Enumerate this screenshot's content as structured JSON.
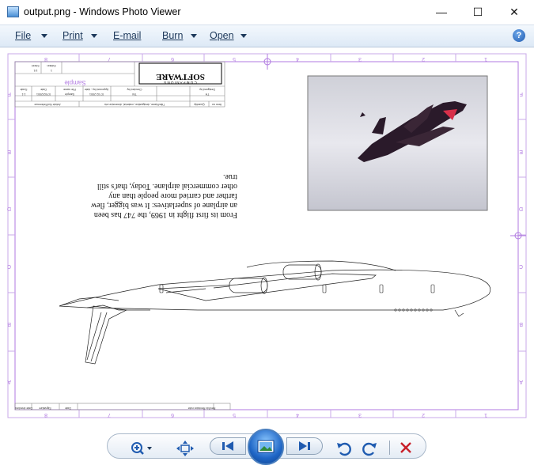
{
  "window": {
    "title": "output.png - Windows Photo Viewer",
    "minimize_glyph": "—",
    "maximize_glyph": "☐",
    "close_glyph": "✕"
  },
  "menu": [
    {
      "label": "File",
      "has_dropdown": true
    },
    {
      "label": "Print",
      "has_dropdown": true
    },
    {
      "label": "E-mail",
      "has_dropdown": false
    },
    {
      "label": "Burn",
      "has_dropdown": true
    },
    {
      "label": "Open",
      "has_dropdown": true
    }
  ],
  "help_glyph": "?",
  "drawing": {
    "title_block": {
      "logo_line1": "SOFTWARE",
      "logo_line2": "C O M P A N I O N S",
      "sample": "Sample",
      "sheet": "Sheet",
      "sheet_value": "1/1",
      "edition": "Edition",
      "edition_value": "1",
      "scale": "Scale",
      "scale_value": "1:1",
      "date": "Date",
      "date_value": "07/02/2001",
      "file_name": "File name",
      "file_name_value": "Sample",
      "approved_by": "Approved by - date",
      "approved_value": "07.02.2001",
      "checked_by": "Checked by",
      "checked_value": "TM",
      "designed_by": "Designed by",
      "designed_value": "TH",
      "article_no": "Article No/Reference",
      "title_name": "Title/Name, designation, material, dimension etc",
      "quantity": "Quantity",
      "item_no": "Item no",
      "revision_note": "Rev/No  Revision note",
      "signature": "Signature",
      "date_checked": "Date checked",
      "date2": "Date"
    },
    "body_text": [
      "From its first flight in 1969, the 747 has been",
      "an airplane of superlatives: It was bigger, flew",
      "farther and carried more people than any",
      "other commercial airplane. Today, that's still",
      "true."
    ],
    "border_letters": [
      "F",
      "E",
      "D",
      "C",
      "B",
      "A"
    ],
    "border_numbers": [
      "8",
      "7",
      "6",
      "5",
      "4",
      "3",
      "2",
      "1"
    ]
  },
  "toolbar": {
    "zoom_glyph": "⊕",
    "actual_size_glyph": "⊞",
    "previous_glyph": "⏮",
    "slideshow_glyph": "▣",
    "next_glyph": "⏭",
    "rotate_ccw_glyph": "↺",
    "rotate_cw_glyph": "↻",
    "delete_glyph": "✕"
  }
}
